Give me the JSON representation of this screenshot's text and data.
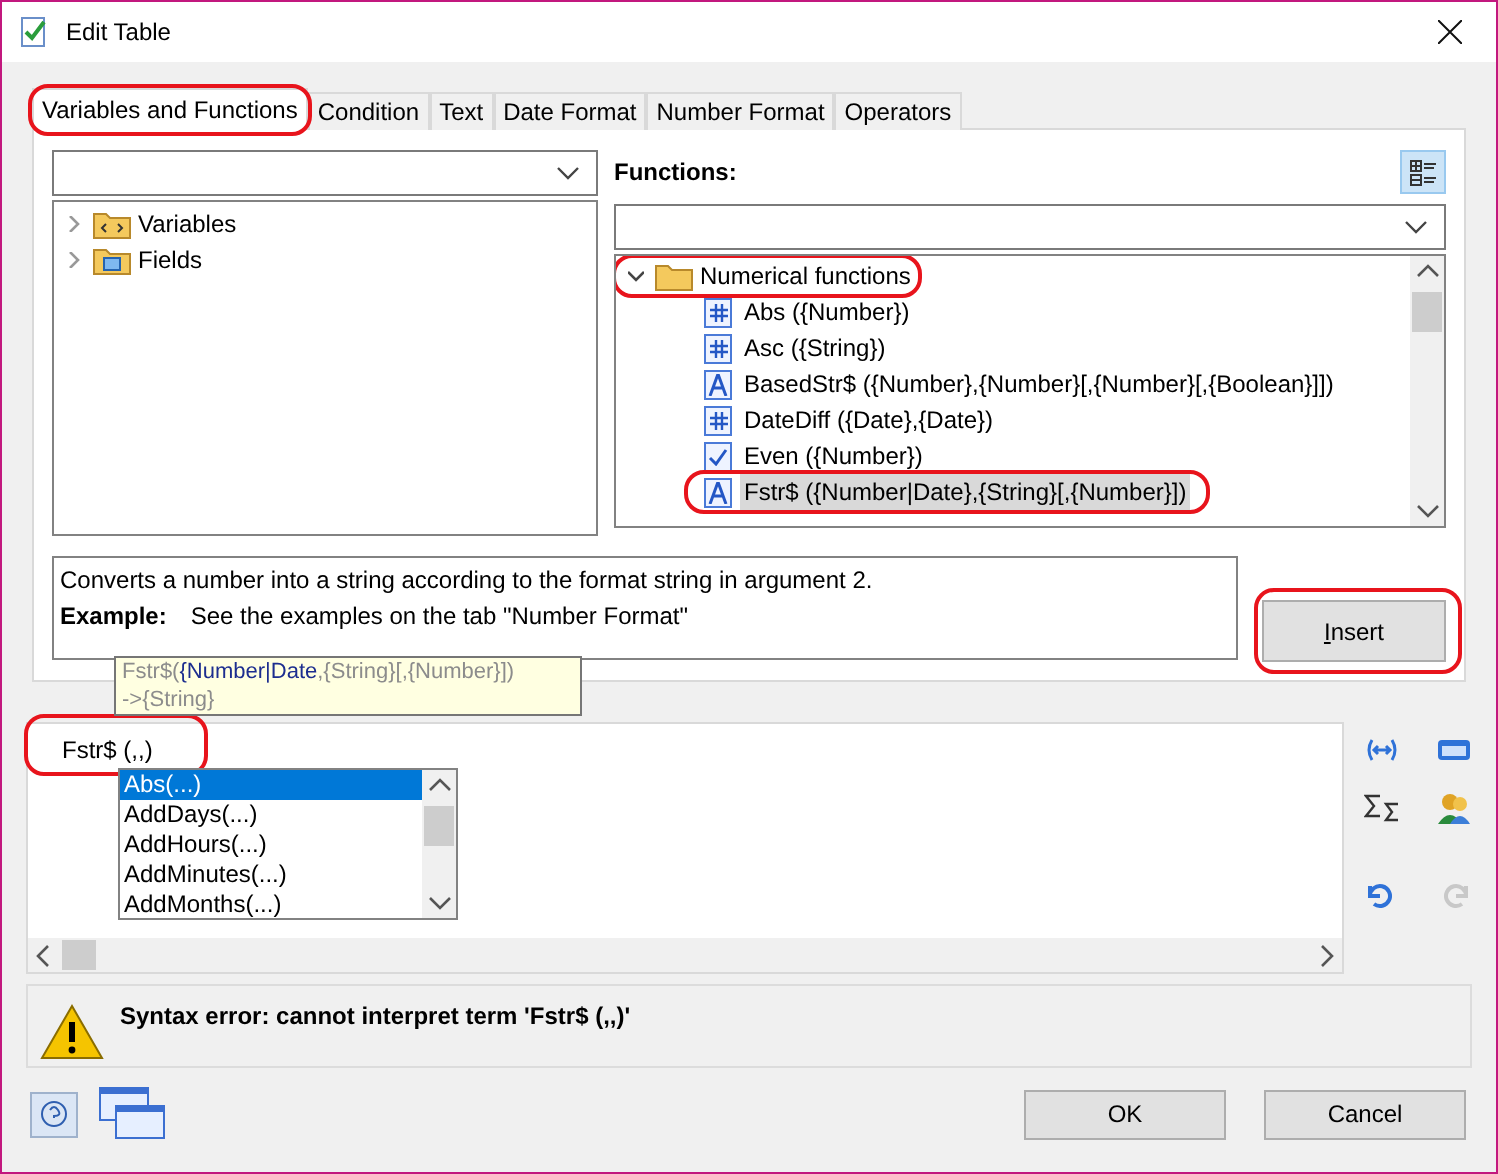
{
  "window": {
    "title": "Edit Table"
  },
  "tabs": [
    {
      "label": "Variables and Functions",
      "selected": true,
      "highlighted": true
    },
    {
      "label": "Condition",
      "selected": false,
      "highlighted": false
    },
    {
      "label": "Text",
      "selected": false,
      "highlighted": false
    },
    {
      "label": "Date Format",
      "selected": false,
      "highlighted": false
    },
    {
      "label": "Number Format",
      "selected": false,
      "highlighted": false
    },
    {
      "label": "Operators",
      "selected": false,
      "highlighted": false
    }
  ],
  "left_tree": [
    {
      "label": "Variables",
      "kind": "variables",
      "expanded": false
    },
    {
      "label": "Fields",
      "kind": "fields",
      "expanded": false
    }
  ],
  "functions_label": "Functions:",
  "function_tree": {
    "label": "Numerical functions",
    "expanded": true,
    "highlighted": true,
    "children": [
      {
        "label": "Abs ({Number})",
        "kind": "number",
        "selected": false,
        "highlighted": false
      },
      {
        "label": "Asc ({String})",
        "kind": "number",
        "selected": false,
        "highlighted": false
      },
      {
        "label": "BasedStr$ ({Number},{Number}[,{Number}[,{Boolean}]])",
        "kind": "text",
        "selected": false,
        "highlighted": false
      },
      {
        "label": "DateDiff ({Date},{Date})",
        "kind": "number",
        "selected": false,
        "highlighted": false
      },
      {
        "label": "Even ({Number})",
        "kind": "boolean",
        "selected": false,
        "highlighted": false
      },
      {
        "label": "Fstr$ ({Number|Date},{String}[,{Number}])",
        "kind": "text",
        "selected": true,
        "highlighted": true
      }
    ]
  },
  "description": {
    "text": "Converts a number into a string according to the format string in argument 2.",
    "example_label": "Example:",
    "example": "See the examples on the tab \"Number Format\""
  },
  "insert_button": {
    "label": "Insert",
    "highlighted": true
  },
  "tooltip": {
    "parts": [
      {
        "text": "Fstr$(",
        "current": false
      },
      {
        "text": "{Number|Date",
        "current": true
      },
      {
        "text": ",{String}[,{Number}])",
        "current": false
      }
    ],
    "returns": "->{String}"
  },
  "editor": {
    "value": "Fstr$ (,,)",
    "highlighted": true
  },
  "autocomplete": [
    {
      "label": "Abs(...)",
      "selected": true
    },
    {
      "label": "AddDays(...)",
      "selected": false
    },
    {
      "label": "AddHours(...)",
      "selected": false
    },
    {
      "label": "AddMinutes(...)",
      "selected": false
    },
    {
      "label": "AddMonths(...)",
      "selected": false
    }
  ],
  "error": "Syntax error: cannot interpret term 'Fstr$ (,,)'",
  "buttons": [
    {
      "label": "OK"
    },
    {
      "label": "Cancel"
    }
  ]
}
